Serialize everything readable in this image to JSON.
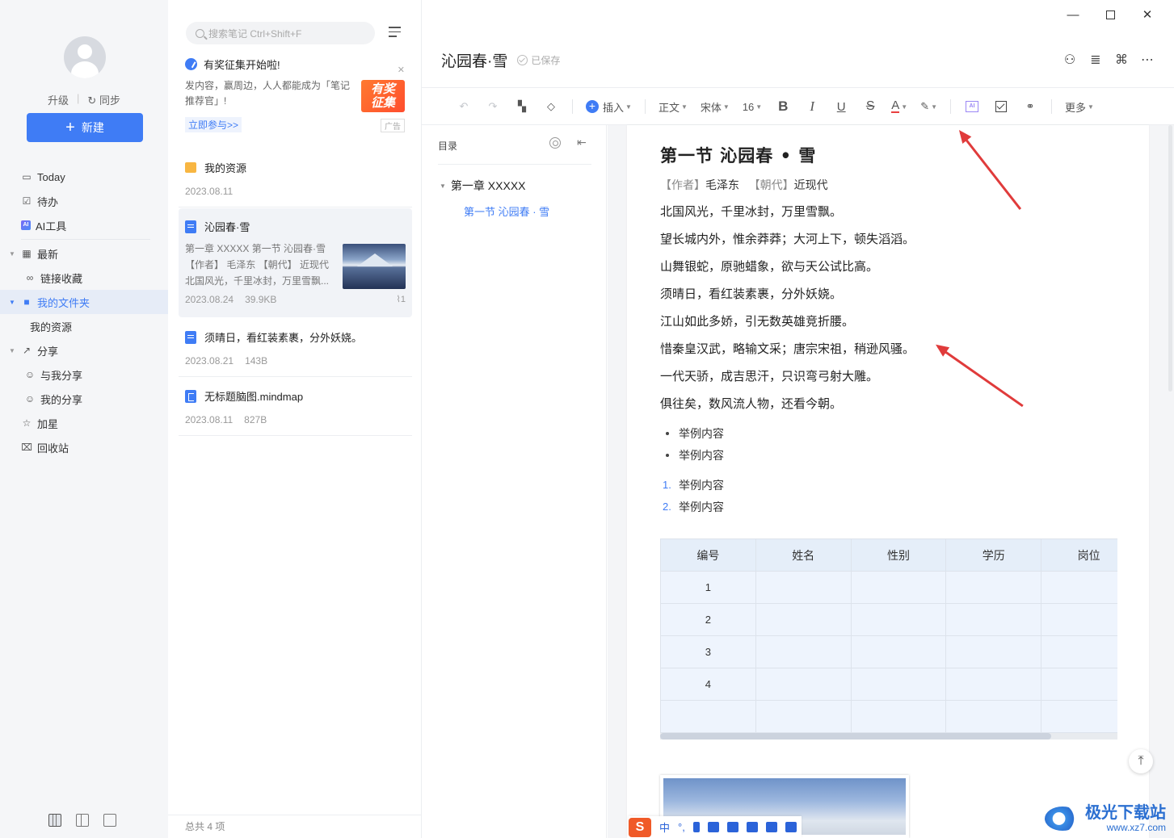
{
  "sidebar": {
    "upgrade": "升级",
    "sync": "同步",
    "new_button": "新建",
    "items": [
      {
        "label": "Today"
      },
      {
        "label": "待办"
      },
      {
        "label": "AI工具"
      },
      {
        "label": "最新"
      },
      {
        "label": "链接收藏"
      },
      {
        "label": "我的文件夹"
      },
      {
        "label": "我的资源"
      },
      {
        "label": "分享"
      },
      {
        "label": "与我分享"
      },
      {
        "label": "我的分享"
      },
      {
        "label": "加星"
      },
      {
        "label": "回收站"
      }
    ]
  },
  "notelist": {
    "search_placeholder": "搜索笔记 Ctrl+Shift+F",
    "promo": {
      "title": "有奖征集开始啦!",
      "body": "发内容，赢周边，人人都能成为「笔记推荐官」!",
      "badge_line1": "有奖",
      "badge_line2": "征集",
      "link": "立即参与>>",
      "ad": "广告"
    },
    "notes": [
      {
        "title": "我的资源",
        "date": "2023.08.11",
        "size": ""
      },
      {
        "title": "沁园春·雪",
        "excerpt": "第一章 XXXXX 第一节 沁园春·雪 【作者】 毛泽东 【朝代】 近现代 北国风光，千里冰封，万里雪飘...",
        "date": "2023.08.24",
        "size": "39.9KB",
        "attachments": "1"
      },
      {
        "title": "须晴日，看红装素裹，分外妖娆。",
        "date": "2023.08.21",
        "size": "143B"
      },
      {
        "title": "无标题脑图.mindmap",
        "date": "2023.08.11",
        "size": "827B"
      }
    ],
    "footer": "总共 4 项"
  },
  "editor": {
    "title": "沁园春·雪",
    "saved": "已保存",
    "toolbar": {
      "insert": "插入",
      "style": "正文",
      "font": "宋体",
      "size": "16",
      "bold": "B",
      "italic": "I",
      "underline": "U",
      "strike": "S",
      "font_color": "A",
      "more": "更多",
      "ai": "AI"
    },
    "toc": {
      "head": "目录",
      "h1": "第一章 XXXXX",
      "h2": "第一节 沁园春 · 雪"
    },
    "doc": {
      "heading": "第一节  沁园春 • 雪",
      "author_tag": "【作者】",
      "author": "毛泽东",
      "dynasty_tag": "【朝代】",
      "dynasty": "近现代",
      "lines": [
        "北国风光，千里冰封，万里雪飘。",
        "望长城内外，惟余莽莽；大河上下，顿失滔滔。",
        "山舞银蛇，原驰蜡象，欲与天公试比高。",
        "须晴日，看红装素裹，分外妖娆。",
        "江山如此多娇，引无数英雄竞折腰。",
        "惜秦皇汉武，略输文采；唐宗宋祖，稍逊风骚。",
        "一代天骄，成吉思汗，只识弯弓射大雕。",
        "俱往矣，数风流人物，还看今朝。"
      ],
      "bullets": [
        "举例内容",
        "举例内容"
      ],
      "ordered": [
        "举例内容",
        "举例内容"
      ],
      "ordered_nums": [
        "1.",
        "2."
      ],
      "table": {
        "headers": [
          "编号",
          "姓名",
          "性别",
          "学历",
          "岗位"
        ],
        "rows": [
          "1",
          "2",
          "3",
          "4",
          ""
        ]
      }
    }
  },
  "ime": {
    "lang": "中"
  },
  "watermark": {
    "line1": "极光下载站",
    "line2": "www.xz7.com"
  },
  "colors": {
    "accent": "#3f7cf5",
    "annotation": "#e03b3b"
  }
}
